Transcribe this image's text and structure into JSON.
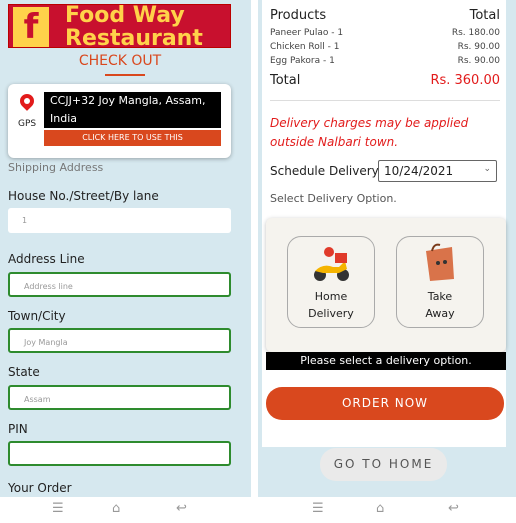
{
  "header": {
    "logo_letter": "f",
    "title_line1": "Food Way",
    "title_line2": "Restaurant",
    "checkout": "CHECK OUT"
  },
  "gps": {
    "label": "GPS",
    "address_line1": "CCJJ+32 Joy Mangla, Assam,",
    "address_line2": "India",
    "button": "CLICK HERE TO USE THIS"
  },
  "shipping": {
    "section": "Shipping Address",
    "house_label": "House No./Street/By lane",
    "house_value": "1",
    "address_label": "Address Line",
    "address_placeholder": "Address line",
    "town_label": "Town/City",
    "town_value": "Joy Mangla",
    "state_label": "State",
    "state_value": "Assam",
    "pin_label": "PIN",
    "pin_value": ""
  },
  "your_order": "Your Order",
  "order": {
    "col_products": "Products",
    "col_total": "Total",
    "items": [
      {
        "name": "Paneer Pulao - 1",
        "price": "Rs. 180.00"
      },
      {
        "name": "Chicken Roll - 1",
        "price": "Rs. 90.00"
      },
      {
        "name": "Egg Pakora - 1",
        "price": "Rs. 90.00"
      }
    ],
    "total_label": "Total",
    "total_value": "Rs. 360.00"
  },
  "delivery_note": "Delivery charges may be applied outside Nalbari town.",
  "schedule": {
    "label": "Schedule Delivery",
    "date": "10/24/2021"
  },
  "options": {
    "label": "Select Delivery Option.",
    "home_line1": "Home",
    "home_line2": "Delivery",
    "take_line1": "Take",
    "take_line2": "Away",
    "warning": "Please select a delivery option."
  },
  "buttons": {
    "order_now": "ORDER NOW",
    "go_home": "GO TO HOME"
  },
  "icons": [
    "menu-icon",
    "home-icon",
    "back-icon",
    "map-pin-icon",
    "scooter-icon",
    "takeaway-bag-icon"
  ],
  "colors": {
    "brand_red": "#c8102e",
    "accent_orange": "#d9481e",
    "brand_yellow": "#ffd24a",
    "field_green": "#2e8b2e"
  }
}
